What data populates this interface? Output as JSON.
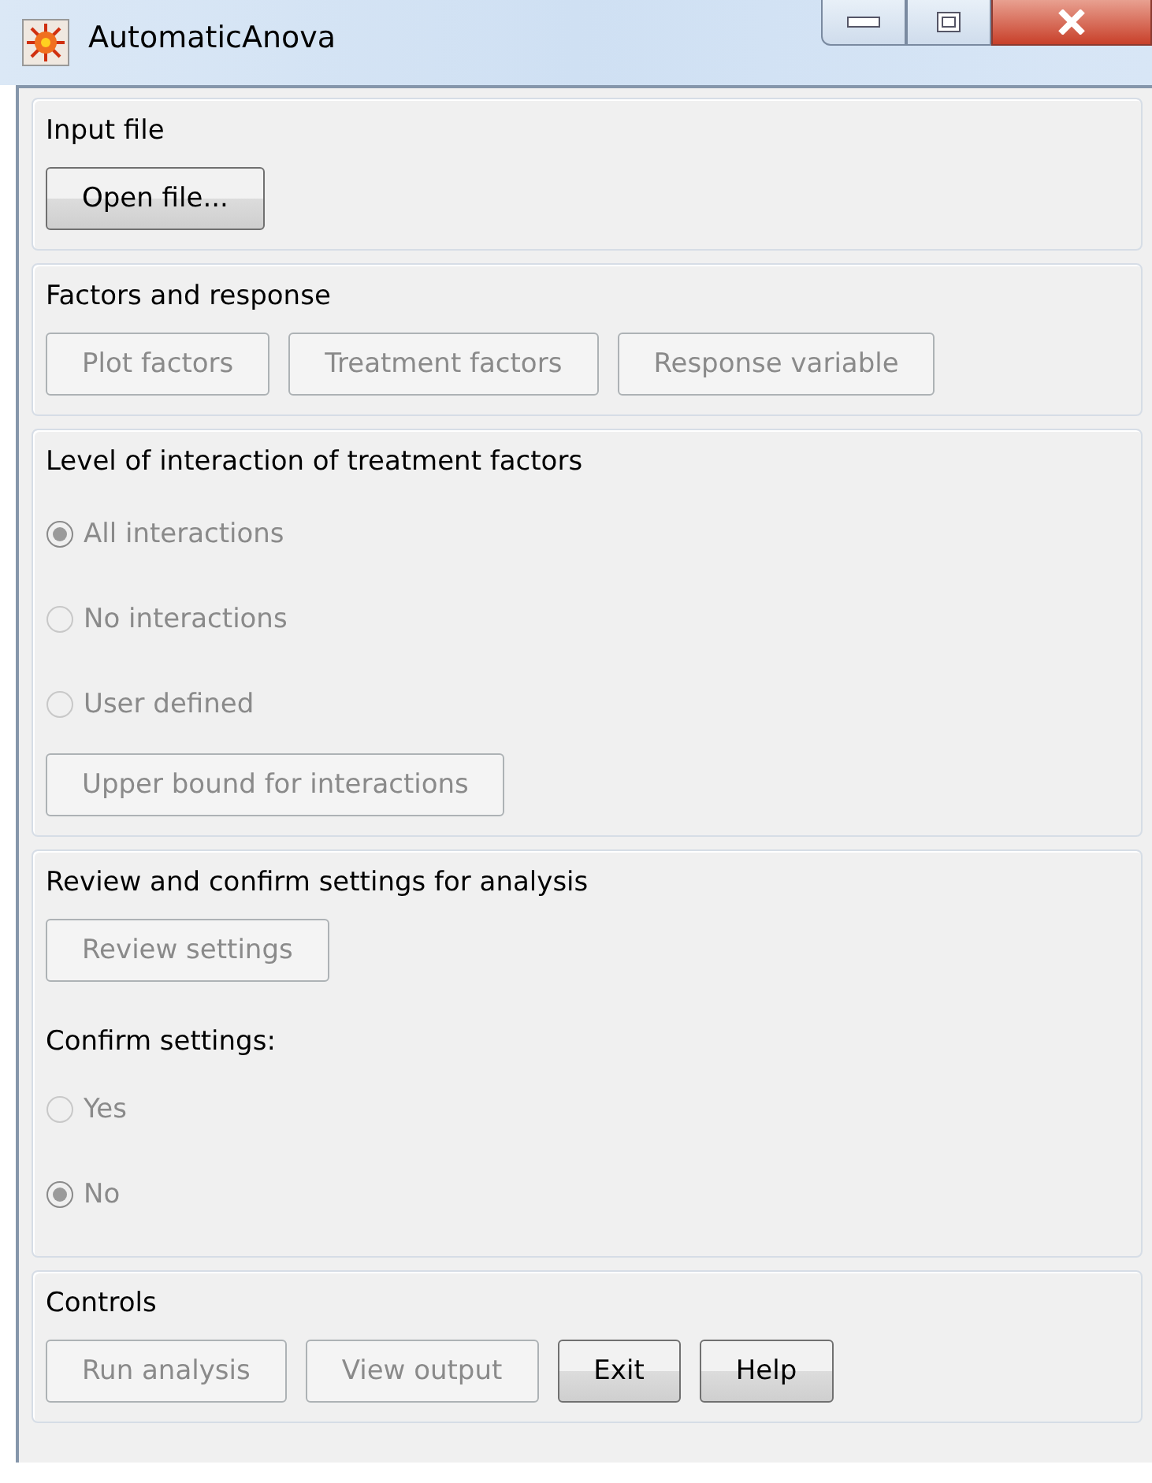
{
  "window": {
    "title": "AutomaticAnova"
  },
  "sections": [
    {
      "title": "Input file",
      "items": [
        {
          "kind": "buttons",
          "buttons": [
            {
              "label": "Open file...",
              "disabled": false
            }
          ]
        }
      ]
    },
    {
      "title": "Factors and response",
      "items": [
        {
          "kind": "buttons",
          "buttons": [
            {
              "label": "Plot factors",
              "disabled": true
            },
            {
              "label": "Treatment factors",
              "disabled": true
            },
            {
              "label": "Response variable",
              "disabled": true
            }
          ]
        }
      ]
    },
    {
      "title": "Level of interaction of treatment factors",
      "items": [
        {
          "kind": "radio",
          "label": "All interactions",
          "selected": true,
          "disabled": true
        },
        {
          "kind": "radio",
          "label": "No interactions",
          "selected": false,
          "disabled": true
        },
        {
          "kind": "radio",
          "label": "User defined",
          "selected": false,
          "disabled": true
        },
        {
          "kind": "buttons",
          "buttons": [
            {
              "label": "Upper bound for interactions",
              "disabled": true
            }
          ]
        }
      ]
    },
    {
      "title": "Review and confirm settings for analysis",
      "items": [
        {
          "kind": "buttons",
          "buttons": [
            {
              "label": "Review settings",
              "disabled": true
            }
          ]
        },
        {
          "kind": "label",
          "text": "Confirm settings:"
        },
        {
          "kind": "radio",
          "label": "Yes",
          "selected": false,
          "disabled": true
        },
        {
          "kind": "radio",
          "label": "No",
          "selected": true,
          "disabled": true
        }
      ]
    },
    {
      "title": "Controls",
      "items": [
        {
          "kind": "buttons",
          "buttons": [
            {
              "label": "Run analysis",
              "disabled": true
            },
            {
              "label": "View output",
              "disabled": true
            },
            {
              "label": "Exit",
              "disabled": false
            },
            {
              "label": "Help",
              "disabled": false
            }
          ]
        }
      ]
    }
  ]
}
